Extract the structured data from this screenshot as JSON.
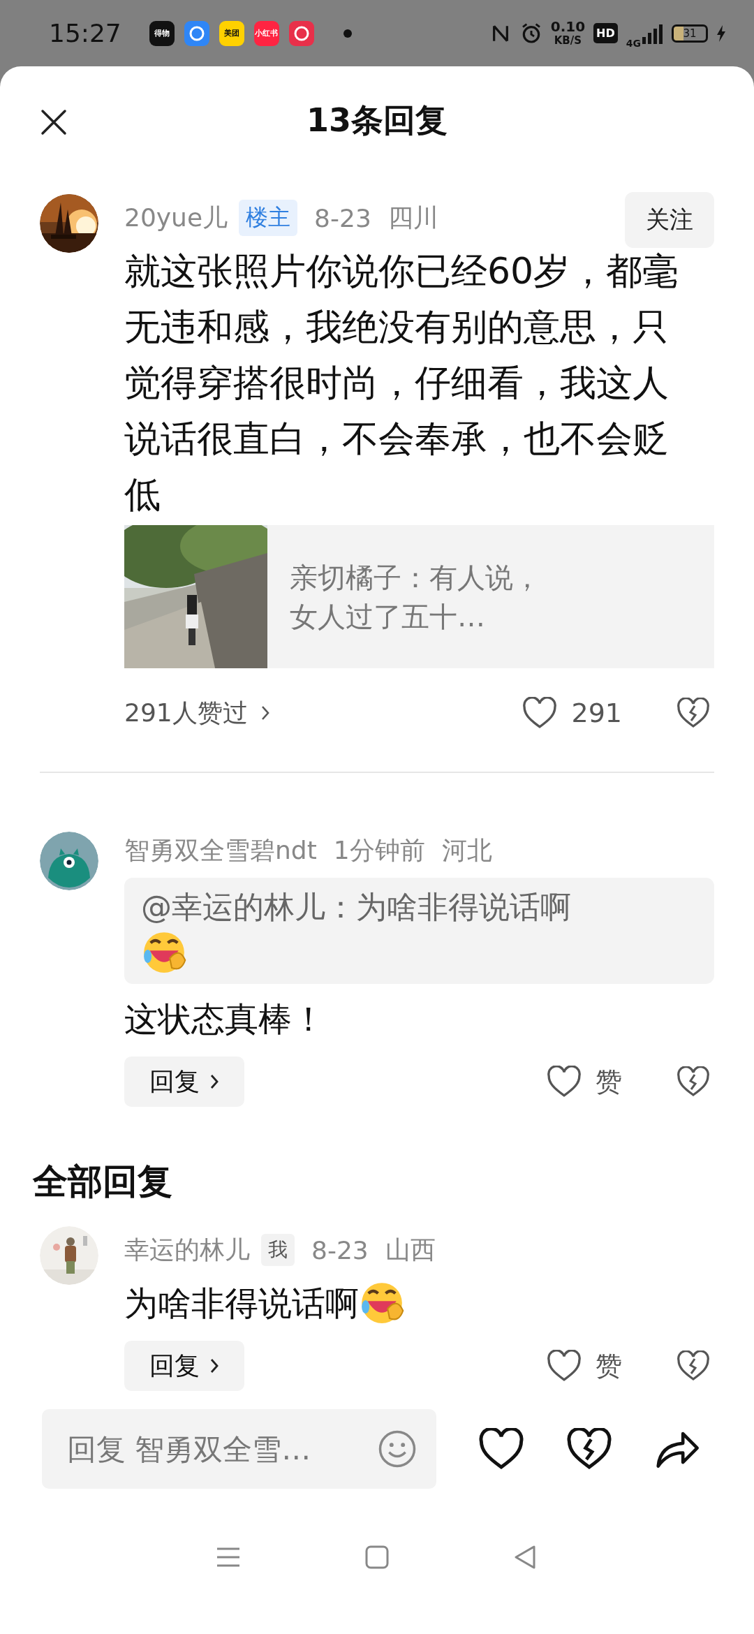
{
  "status_bar": {
    "time": "15:27",
    "apps": [
      {
        "kind": "text",
        "label": "得物",
        "color": "#111111"
      },
      {
        "kind": "logo",
        "color": "#2f86f6"
      },
      {
        "kind": "text",
        "label": "美团",
        "color": "#ffd100"
      },
      {
        "kind": "text",
        "label": "小红书",
        "color": "#ff2442"
      },
      {
        "kind": "logo",
        "color": "#e8304a"
      }
    ],
    "net_speed": "0.10",
    "net_unit": "KB/S",
    "hd": "HD",
    "network": "4G",
    "battery": "31"
  },
  "header": {
    "title": "13条回复"
  },
  "main_comment": {
    "author": "20yue儿",
    "badge": "楼主",
    "date": "8-23",
    "location": "四川",
    "follow": "关注",
    "text": "就这张照片你说你已经60岁，都毫无违和感，我绝没有别的意思，只觉得穿搭很时尚，仔细看，我这人说话很直白，不会奉承，也不会贬低",
    "quote_lines": [
      "亲切橘子：有人说，",
      "女人过了五十…"
    ],
    "likes_summary": "291人赞过",
    "like_count": "291",
    "liked": false
  },
  "reply_comment": {
    "author": "智勇双全雪碧ndt",
    "time": "1分钟前",
    "location": "河北",
    "quote": "@幸运的林儿：为啥非得说话啊",
    "quote_emoji": true,
    "text": "这状态真棒！",
    "reply_button": "回复",
    "like_label": "赞",
    "liked": false
  },
  "section_title": "全部回复",
  "replies": [
    {
      "author": "幸运的林儿",
      "badge": "我",
      "date": "8-23",
      "location": "山西",
      "text": "为啥非得说话啊",
      "emoji": true,
      "reply_button": "回复",
      "like_label": "赞",
      "liked": false
    }
  ],
  "composer": {
    "placeholder": "回复 智勇双全雪…"
  }
}
